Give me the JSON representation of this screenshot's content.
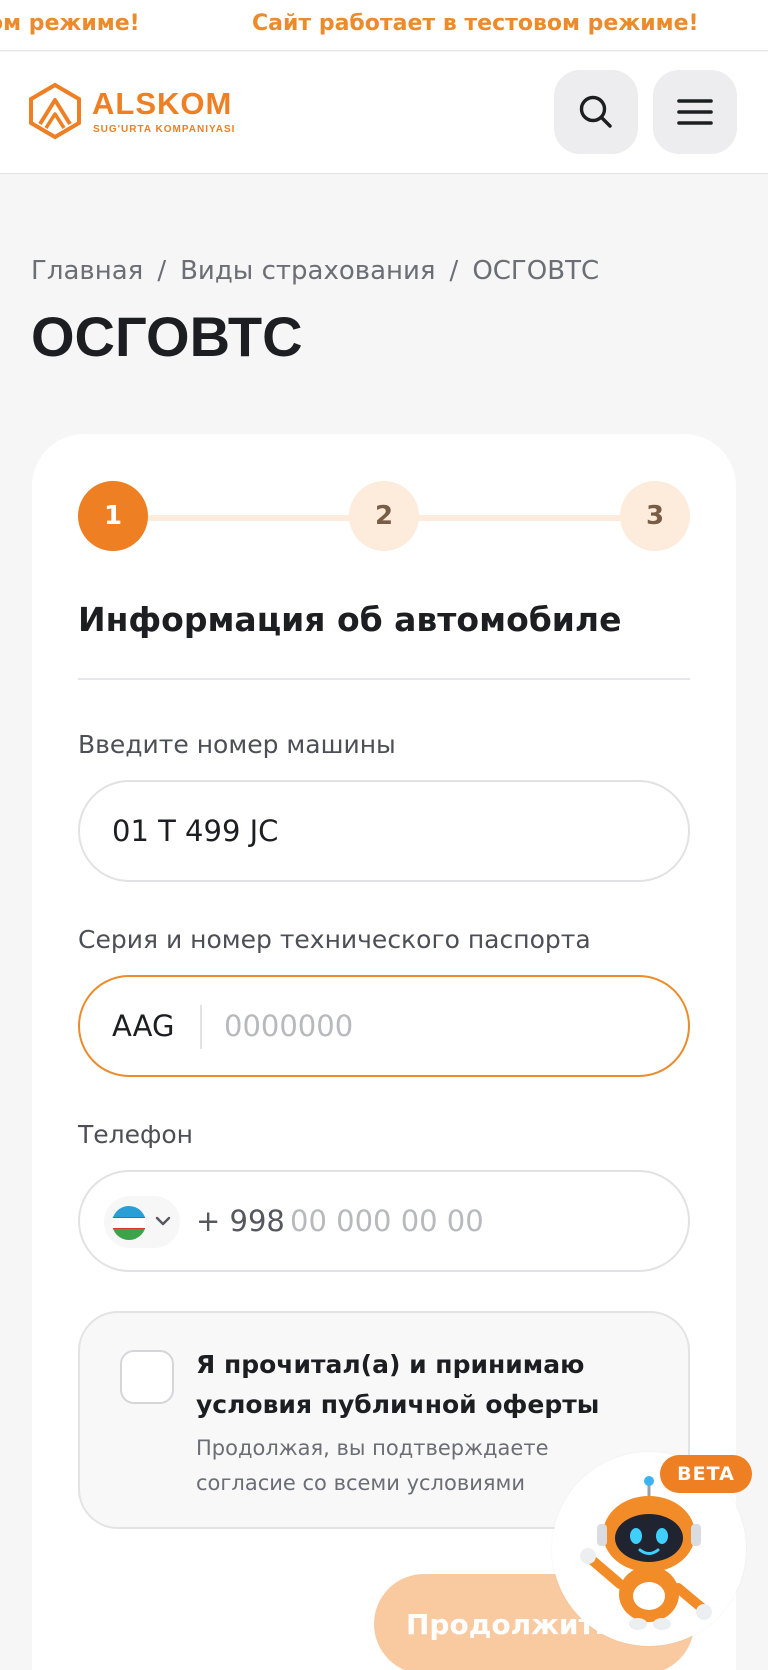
{
  "ticker": {
    "text_left": "ом режиме!",
    "text_right": "Сайт работает в тестовом режиме!"
  },
  "header": {
    "logo_name": "ALSKOM",
    "logo_subtitle": "SUG'URTA KOMPANIYASI",
    "search_icon": "search-icon",
    "menu_icon": "hamburger-menu-icon"
  },
  "breadcrumb": {
    "items": [
      "Главная",
      "Виды страхования",
      "ОСГОВТС"
    ],
    "separator": "/"
  },
  "page_title": "ОСГОВТС",
  "stepper": {
    "steps": [
      "1",
      "2",
      "3"
    ],
    "active_step": 1
  },
  "form": {
    "section_title": "Информация об автомобиле",
    "car_number": {
      "label": "Введите номер машины",
      "value": "01 T 499 JC"
    },
    "tech_passport": {
      "label": "Серия и номер технического паспорта",
      "series": "AAG",
      "placeholder": "0000000"
    },
    "phone": {
      "label": "Телефон",
      "country_code": "+ 998",
      "placeholder": "00 000 00 00",
      "flag_icon": "uzbekistan-flag-icon"
    },
    "consent": {
      "title": "Я прочитал(а) и принимаю условия публичной оферты",
      "subtitle": "Продолжая, вы подтверждаете согласие со всеми условиями",
      "checked": false
    },
    "continue_label": "Продолжить"
  },
  "assistant": {
    "badge": "BETA",
    "icon": "robot-assistant-icon"
  },
  "colors": {
    "accent": "#ee7f22",
    "accent_light": "#fdebdc",
    "ticker_text": "#ec8b2c",
    "background": "#f6f6f7"
  }
}
